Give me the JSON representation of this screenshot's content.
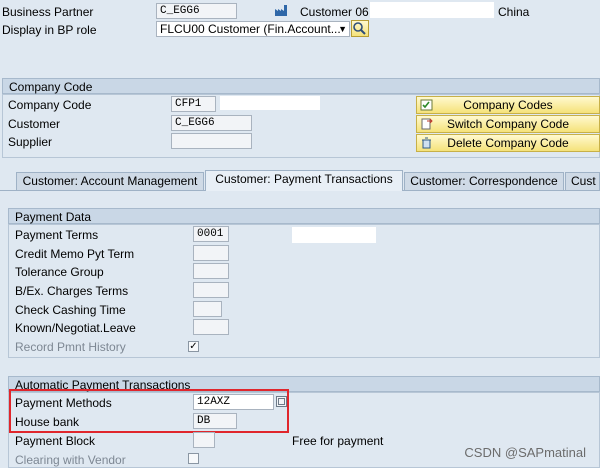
{
  "header": {
    "business_partner_label": "Business Partner",
    "business_partner_value": "C_EGG6",
    "partner_name": "Customer 06",
    "country": "China",
    "display_role_label": "Display in BP role",
    "display_role_value": "FLCU00 Customer (Fin.Account..."
  },
  "company_code": {
    "section_title": "Company Code",
    "company_code_label": "Company Code",
    "company_code_value": "CFP1",
    "customer_label": "Customer",
    "customer_value": "C_EGG6",
    "supplier_label": "Supplier",
    "supplier_value": "",
    "buttons": {
      "company_codes": "Company Codes",
      "switch_company_code": "Switch Company Code",
      "delete_company_code": "Delete Company Code"
    }
  },
  "tabs": [
    {
      "label": "Customer: Account Management"
    },
    {
      "label": "Customer: Payment Transactions"
    },
    {
      "label": "Customer: Correspondence"
    },
    {
      "label": "Cust"
    }
  ],
  "payment_data": {
    "section_title": "Payment Data",
    "payment_terms_label": "Payment Terms",
    "payment_terms_value": "0001",
    "credit_memo_label": "Credit Memo Pyt Term",
    "tolerance_group_label": "Tolerance Group",
    "charges_terms_label": "B/Ex. Charges Terms",
    "check_cashing_label": "Check Cashing Time",
    "known_leave_label": "Known/Negotiat.Leave",
    "record_history_label": "Record Pmnt History",
    "record_history_checked": true
  },
  "automatic_payment": {
    "section_title": "Automatic Payment Transactions",
    "payment_methods_label": "Payment Methods",
    "payment_methods_value": "12AXZ",
    "house_bank_label": "House bank",
    "house_bank_value": "DB",
    "payment_block_label": "Payment Block",
    "payment_block_text": "Free for payment",
    "clearing_vendor_label": "Clearing with Vendor"
  },
  "watermark": "CSDN @SAPmatinal",
  "colors": {
    "background": "#dfe8f1",
    "highlight_box": "#e0262c",
    "button_yellow": "#f5e27a"
  }
}
